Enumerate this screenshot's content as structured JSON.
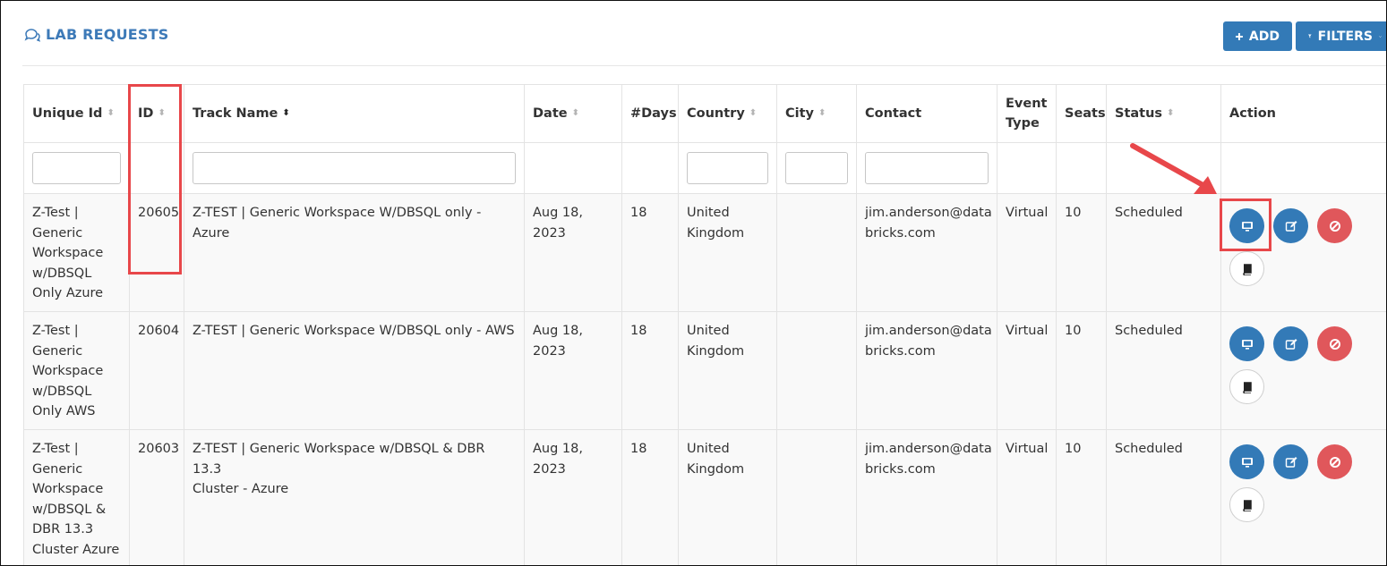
{
  "panel": {
    "title": "LAB REQUESTS",
    "icon": "comments-icon",
    "accent_color": "#3d7ab8"
  },
  "toolbar": {
    "add_label": "ADD",
    "filters_label": "FILTERS"
  },
  "table": {
    "columns": {
      "unique_id": "Unique Id",
      "id": "ID",
      "track_name": "Track Name",
      "date": "Date",
      "days": "#Days",
      "country": "Country",
      "city": "City",
      "contact": "Contact",
      "event_type_1": "Event",
      "event_type_2": "Type",
      "seats": "Seats",
      "status": "Status",
      "action": "Action"
    },
    "rows": [
      {
        "unique_id": [
          "Z-Test |",
          "Generic",
          "Workspace",
          "w/DBSQL",
          "Only Azure"
        ],
        "id": "20605",
        "track_name": "Z-TEST | Generic Workspace W/DBSQL only - Azure",
        "date": [
          "Aug 18,",
          "2023"
        ],
        "days": "18",
        "country": [
          "United",
          "Kingdom"
        ],
        "city": "",
        "contact": [
          "jim.anderson@data",
          "bricks.com"
        ],
        "event_type": "Virtual",
        "seats": "10",
        "status": "Scheduled"
      },
      {
        "unique_id": [
          "Z-Test |",
          "Generic",
          "Workspace",
          "w/DBSQL",
          "Only AWS"
        ],
        "id": "20604",
        "track_name": "Z-TEST | Generic Workspace W/DBSQL only - AWS",
        "date": [
          "Aug 18,",
          "2023"
        ],
        "days": "18",
        "country": [
          "United",
          "Kingdom"
        ],
        "city": "",
        "contact": [
          "jim.anderson@data",
          "bricks.com"
        ],
        "event_type": "Virtual",
        "seats": "10",
        "status": "Scheduled"
      },
      {
        "unique_id": [
          "Z-Test |",
          "Generic",
          "Workspace",
          "w/DBSQL &",
          "DBR 13.3",
          "Cluster Azure"
        ],
        "id": "20603",
        "track_name": [
          "Z-TEST | Generic Workspace w/DBSQL & DBR 13.3",
          "Cluster - Azure"
        ],
        "date": [
          "Aug 18,",
          "2023"
        ],
        "days": "18",
        "country": [
          "United",
          "Kingdom"
        ],
        "city": "",
        "contact": [
          "jim.anderson@data",
          "bricks.com"
        ],
        "event_type": "Virtual",
        "seats": "10",
        "status": "Scheduled"
      }
    ]
  },
  "row_actions": [
    "desktop-icon",
    "edit-icon",
    "ban-icon",
    "book-icon"
  ],
  "colors": {
    "primary": "#337ab7",
    "danger": "#e0575b",
    "highlight": "#e8474a"
  }
}
